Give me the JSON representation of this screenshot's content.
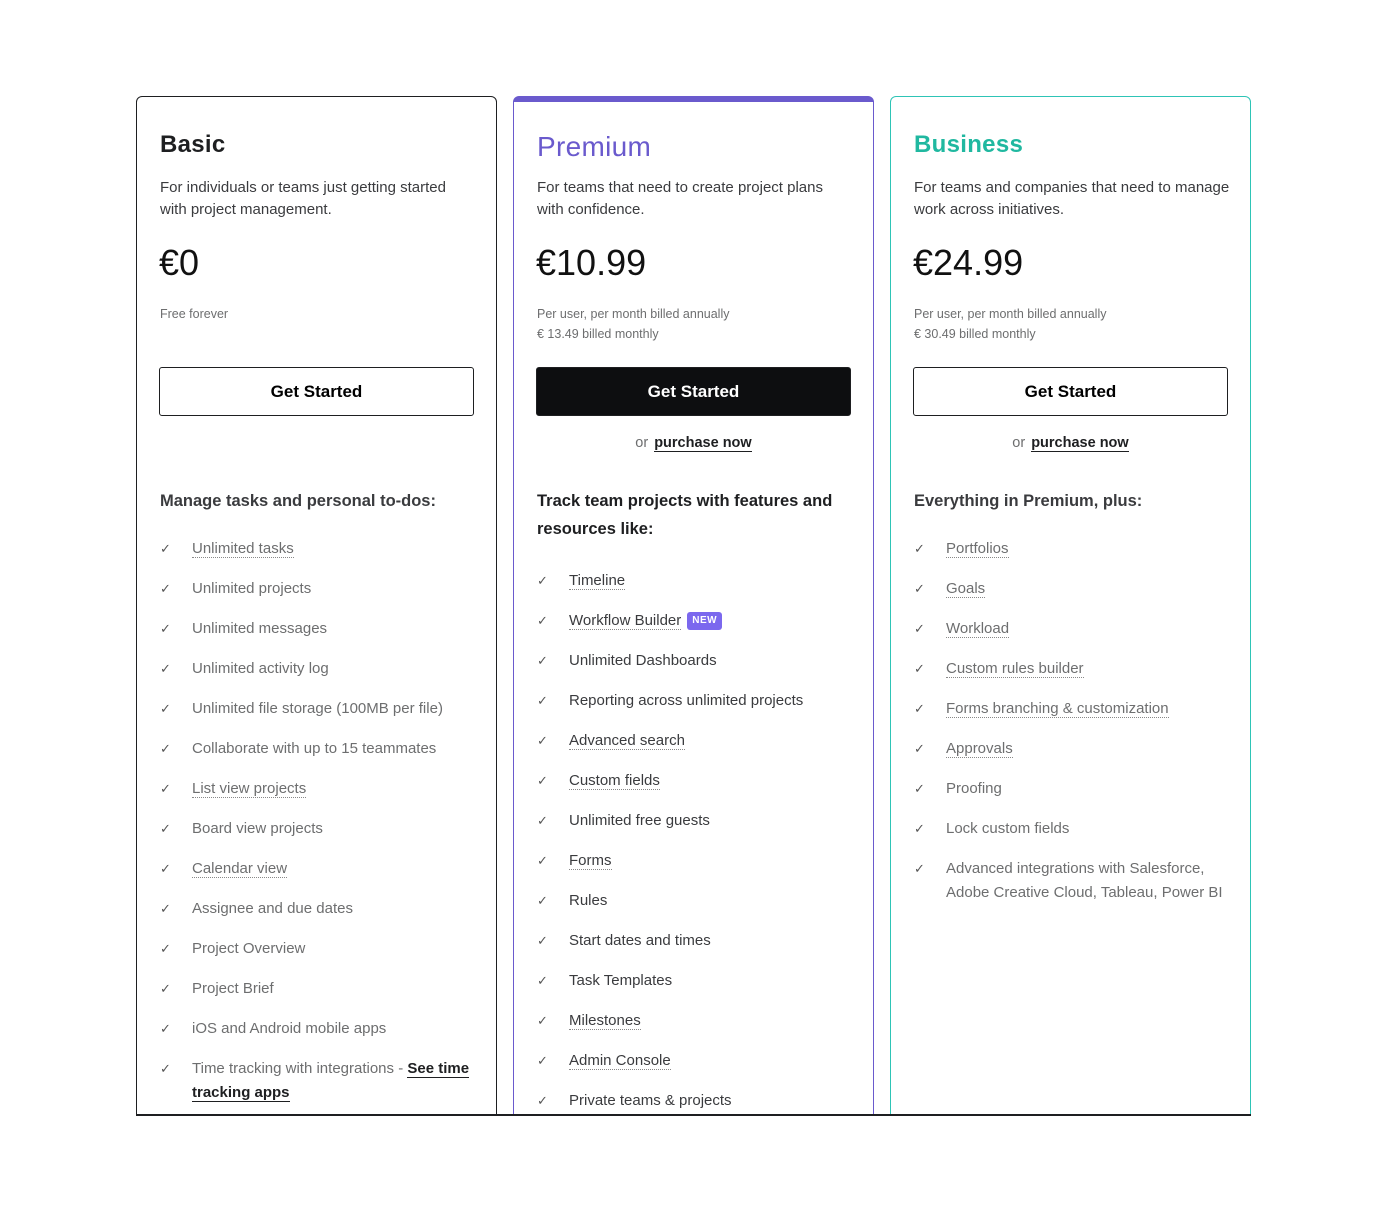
{
  "colors": {
    "premium": "#6a5acd",
    "business": "#20b8a0",
    "badge": "#7b68ee"
  },
  "plans": [
    {
      "name": "Basic",
      "description": "For individuals or teams just getting started with project management.",
      "price": "€0",
      "sub1": "Free forever",
      "sub2": "",
      "button": "Get Started",
      "or": "",
      "purchase": "",
      "features_heading": "Manage tasks and personal to-dos:",
      "features": [
        {
          "label": "Unlimited tasks",
          "link": true
        },
        {
          "label": "Unlimited projects"
        },
        {
          "label": "Unlimited messages"
        },
        {
          "label": "Unlimited activity log"
        },
        {
          "label": "Unlimited file storage (100MB per file)"
        },
        {
          "label": "Collaborate with up to 15 teammates"
        },
        {
          "label": "List view projects",
          "link": true
        },
        {
          "label": "Board view projects"
        },
        {
          "label": "Calendar view",
          "link": true
        },
        {
          "label": "Assignee and due dates"
        },
        {
          "label": "Project Overview"
        },
        {
          "label": "Project Brief"
        },
        {
          "label": "iOS and Android mobile apps"
        },
        {
          "label": "Time tracking with integrations - ",
          "extra": "See time tracking apps"
        }
      ]
    },
    {
      "name": "Premium",
      "description": "For teams that need to create project plans with confidence.",
      "price": "€10.99",
      "sub1": "Per user, per month billed annually",
      "sub2": "€ 13.49 billed monthly",
      "button": "Get Started",
      "or": "or",
      "purchase": "purchase now",
      "features_heading": "Track team projects with features and resources like:",
      "features": [
        {
          "label": "Timeline",
          "link": true
        },
        {
          "label": "Workflow Builder",
          "link": true,
          "badge": "NEW"
        },
        {
          "label": "Unlimited Dashboards"
        },
        {
          "label": "Reporting across unlimited projects"
        },
        {
          "label": "Advanced search",
          "link": true
        },
        {
          "label": "Custom fields",
          "link": true
        },
        {
          "label": "Unlimited free guests"
        },
        {
          "label": "Forms",
          "link": true
        },
        {
          "label": "Rules"
        },
        {
          "label": "Start dates and times"
        },
        {
          "label": "Task Templates"
        },
        {
          "label": "Milestones",
          "link": true
        },
        {
          "label": "Admin Console",
          "link": true
        },
        {
          "label": "Private teams & projects"
        }
      ]
    },
    {
      "name": "Business",
      "description": "For teams and companies that need to manage work across initiatives.",
      "price": "€24.99",
      "sub1": "Per user, per month billed annually",
      "sub2": "€ 30.49 billed monthly",
      "button": "Get Started",
      "or": "or",
      "purchase": "purchase now",
      "features_heading": "Everything in Premium, plus:",
      "features": [
        {
          "label": "Portfolios",
          "link": true
        },
        {
          "label": "Goals",
          "link": true
        },
        {
          "label": "Workload",
          "link": true
        },
        {
          "label": "Custom rules builder",
          "link": true
        },
        {
          "label": "Forms branching & customization",
          "link": true
        },
        {
          "label": "Approvals",
          "link": true
        },
        {
          "label": "Proofing"
        },
        {
          "label": "Lock custom fields"
        },
        {
          "label": "Advanced integrations with Salesforce, Adobe Creative Cloud, Tableau, Power BI"
        }
      ]
    }
  ]
}
